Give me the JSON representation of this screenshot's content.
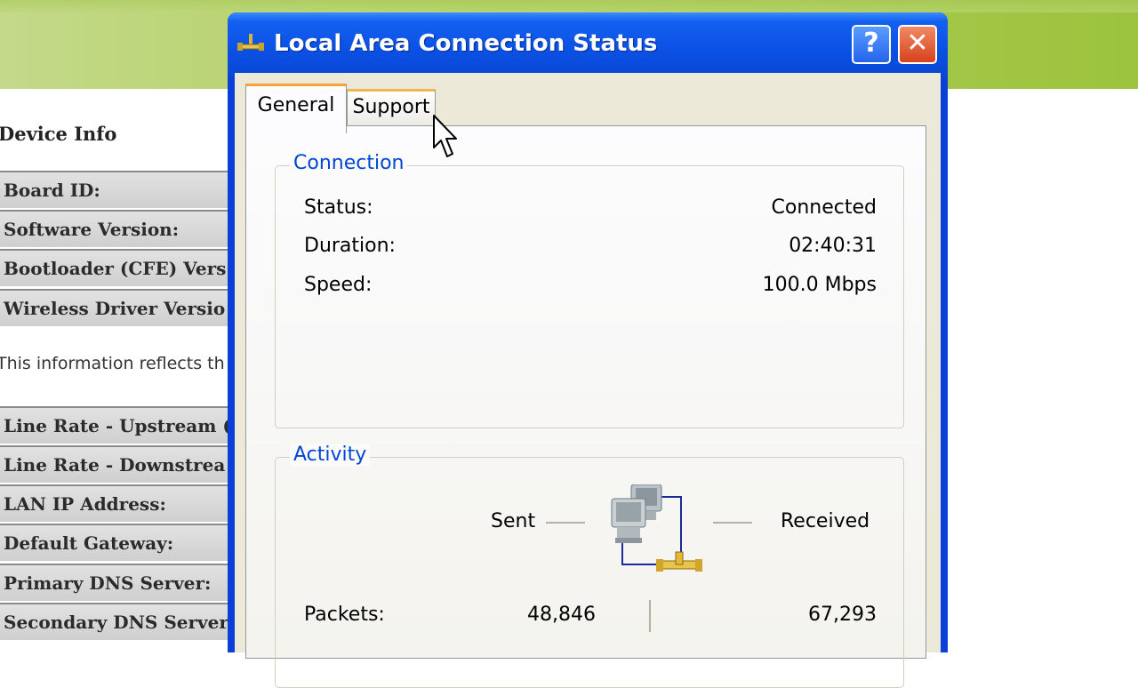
{
  "background": {
    "device_info_title": "Device Info",
    "rows": [
      "Board ID:",
      "Software Version:",
      "Bootloader (CFE) Vers",
      "Wireless Driver Versio",
      "Line Rate - Upstream (",
      "Line Rate - Downstrea",
      "LAN IP Address:",
      "Default Gateway:",
      "Primary DNS Server:",
      "Secondary DNS Server"
    ],
    "note": "This information reflects th"
  },
  "window": {
    "title": "Local Area Connection Status",
    "help_label": "?",
    "close_label": "✕",
    "tabs": [
      {
        "label": "General",
        "active": true
      },
      {
        "label": "Support",
        "active": false
      }
    ]
  },
  "connection": {
    "group_label": "Connection",
    "status_label": "Status:",
    "status_value": "Connected",
    "duration_label": "Duration:",
    "duration_value": "02:40:31",
    "speed_label": "Speed:",
    "speed_value": "100.0 Mbps"
  },
  "activity": {
    "group_label": "Activity",
    "sent_label": "Sent",
    "received_label": "Received",
    "packets_label": "Packets:",
    "packets_sent": "48,846",
    "packets_received": "67,293",
    "icon": "network-computers-icon"
  },
  "colors": {
    "titlebar": "#0b52e6",
    "group_label": "#0046d5",
    "close": "#d7421d",
    "tab_highlight": "#f3a43a",
    "page_header": "#b2cf5f"
  }
}
